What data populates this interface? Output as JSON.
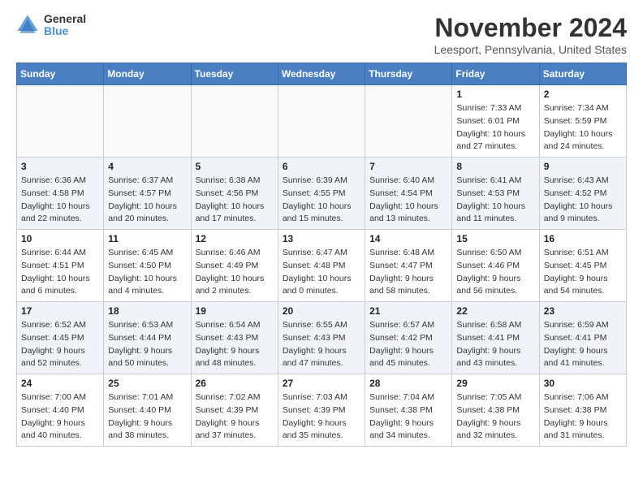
{
  "header": {
    "logo_general": "General",
    "logo_blue": "Blue",
    "month_title": "November 2024",
    "location": "Leesport, Pennsylvania, United States"
  },
  "calendar": {
    "headers": [
      "Sunday",
      "Monday",
      "Tuesday",
      "Wednesday",
      "Thursday",
      "Friday",
      "Saturday"
    ],
    "weeks": [
      [
        {
          "day": "",
          "sunrise": "",
          "sunset": "",
          "daylight": ""
        },
        {
          "day": "",
          "sunrise": "",
          "sunset": "",
          "daylight": ""
        },
        {
          "day": "",
          "sunrise": "",
          "sunset": "",
          "daylight": ""
        },
        {
          "day": "",
          "sunrise": "",
          "sunset": "",
          "daylight": ""
        },
        {
          "day": "",
          "sunrise": "",
          "sunset": "",
          "daylight": ""
        },
        {
          "day": "1",
          "sunrise": "Sunrise: 7:33 AM",
          "sunset": "Sunset: 6:01 PM",
          "daylight": "Daylight: 10 hours and 27 minutes."
        },
        {
          "day": "2",
          "sunrise": "Sunrise: 7:34 AM",
          "sunset": "Sunset: 5:59 PM",
          "daylight": "Daylight: 10 hours and 24 minutes."
        }
      ],
      [
        {
          "day": "3",
          "sunrise": "Sunrise: 6:36 AM",
          "sunset": "Sunset: 4:58 PM",
          "daylight": "Daylight: 10 hours and 22 minutes."
        },
        {
          "day": "4",
          "sunrise": "Sunrise: 6:37 AM",
          "sunset": "Sunset: 4:57 PM",
          "daylight": "Daylight: 10 hours and 20 minutes."
        },
        {
          "day": "5",
          "sunrise": "Sunrise: 6:38 AM",
          "sunset": "Sunset: 4:56 PM",
          "daylight": "Daylight: 10 hours and 17 minutes."
        },
        {
          "day": "6",
          "sunrise": "Sunrise: 6:39 AM",
          "sunset": "Sunset: 4:55 PM",
          "daylight": "Daylight: 10 hours and 15 minutes."
        },
        {
          "day": "7",
          "sunrise": "Sunrise: 6:40 AM",
          "sunset": "Sunset: 4:54 PM",
          "daylight": "Daylight: 10 hours and 13 minutes."
        },
        {
          "day": "8",
          "sunrise": "Sunrise: 6:41 AM",
          "sunset": "Sunset: 4:53 PM",
          "daylight": "Daylight: 10 hours and 11 minutes."
        },
        {
          "day": "9",
          "sunrise": "Sunrise: 6:43 AM",
          "sunset": "Sunset: 4:52 PM",
          "daylight": "Daylight: 10 hours and 9 minutes."
        }
      ],
      [
        {
          "day": "10",
          "sunrise": "Sunrise: 6:44 AM",
          "sunset": "Sunset: 4:51 PM",
          "daylight": "Daylight: 10 hours and 6 minutes."
        },
        {
          "day": "11",
          "sunrise": "Sunrise: 6:45 AM",
          "sunset": "Sunset: 4:50 PM",
          "daylight": "Daylight: 10 hours and 4 minutes."
        },
        {
          "day": "12",
          "sunrise": "Sunrise: 6:46 AM",
          "sunset": "Sunset: 4:49 PM",
          "daylight": "Daylight: 10 hours and 2 minutes."
        },
        {
          "day": "13",
          "sunrise": "Sunrise: 6:47 AM",
          "sunset": "Sunset: 4:48 PM",
          "daylight": "Daylight: 10 hours and 0 minutes."
        },
        {
          "day": "14",
          "sunrise": "Sunrise: 6:48 AM",
          "sunset": "Sunset: 4:47 PM",
          "daylight": "Daylight: 9 hours and 58 minutes."
        },
        {
          "day": "15",
          "sunrise": "Sunrise: 6:50 AM",
          "sunset": "Sunset: 4:46 PM",
          "daylight": "Daylight: 9 hours and 56 minutes."
        },
        {
          "day": "16",
          "sunrise": "Sunrise: 6:51 AM",
          "sunset": "Sunset: 4:45 PM",
          "daylight": "Daylight: 9 hours and 54 minutes."
        }
      ],
      [
        {
          "day": "17",
          "sunrise": "Sunrise: 6:52 AM",
          "sunset": "Sunset: 4:45 PM",
          "daylight": "Daylight: 9 hours and 52 minutes."
        },
        {
          "day": "18",
          "sunrise": "Sunrise: 6:53 AM",
          "sunset": "Sunset: 4:44 PM",
          "daylight": "Daylight: 9 hours and 50 minutes."
        },
        {
          "day": "19",
          "sunrise": "Sunrise: 6:54 AM",
          "sunset": "Sunset: 4:43 PM",
          "daylight": "Daylight: 9 hours and 48 minutes."
        },
        {
          "day": "20",
          "sunrise": "Sunrise: 6:55 AM",
          "sunset": "Sunset: 4:43 PM",
          "daylight": "Daylight: 9 hours and 47 minutes."
        },
        {
          "day": "21",
          "sunrise": "Sunrise: 6:57 AM",
          "sunset": "Sunset: 4:42 PM",
          "daylight": "Daylight: 9 hours and 45 minutes."
        },
        {
          "day": "22",
          "sunrise": "Sunrise: 6:58 AM",
          "sunset": "Sunset: 4:41 PM",
          "daylight": "Daylight: 9 hours and 43 minutes."
        },
        {
          "day": "23",
          "sunrise": "Sunrise: 6:59 AM",
          "sunset": "Sunset: 4:41 PM",
          "daylight": "Daylight: 9 hours and 41 minutes."
        }
      ],
      [
        {
          "day": "24",
          "sunrise": "Sunrise: 7:00 AM",
          "sunset": "Sunset: 4:40 PM",
          "daylight": "Daylight: 9 hours and 40 minutes."
        },
        {
          "day": "25",
          "sunrise": "Sunrise: 7:01 AM",
          "sunset": "Sunset: 4:40 PM",
          "daylight": "Daylight: 9 hours and 38 minutes."
        },
        {
          "day": "26",
          "sunrise": "Sunrise: 7:02 AM",
          "sunset": "Sunset: 4:39 PM",
          "daylight": "Daylight: 9 hours and 37 minutes."
        },
        {
          "day": "27",
          "sunrise": "Sunrise: 7:03 AM",
          "sunset": "Sunset: 4:39 PM",
          "daylight": "Daylight: 9 hours and 35 minutes."
        },
        {
          "day": "28",
          "sunrise": "Sunrise: 7:04 AM",
          "sunset": "Sunset: 4:38 PM",
          "daylight": "Daylight: 9 hours and 34 minutes."
        },
        {
          "day": "29",
          "sunrise": "Sunrise: 7:05 AM",
          "sunset": "Sunset: 4:38 PM",
          "daylight": "Daylight: 9 hours and 32 minutes."
        },
        {
          "day": "30",
          "sunrise": "Sunrise: 7:06 AM",
          "sunset": "Sunset: 4:38 PM",
          "daylight": "Daylight: 9 hours and 31 minutes."
        }
      ]
    ]
  }
}
